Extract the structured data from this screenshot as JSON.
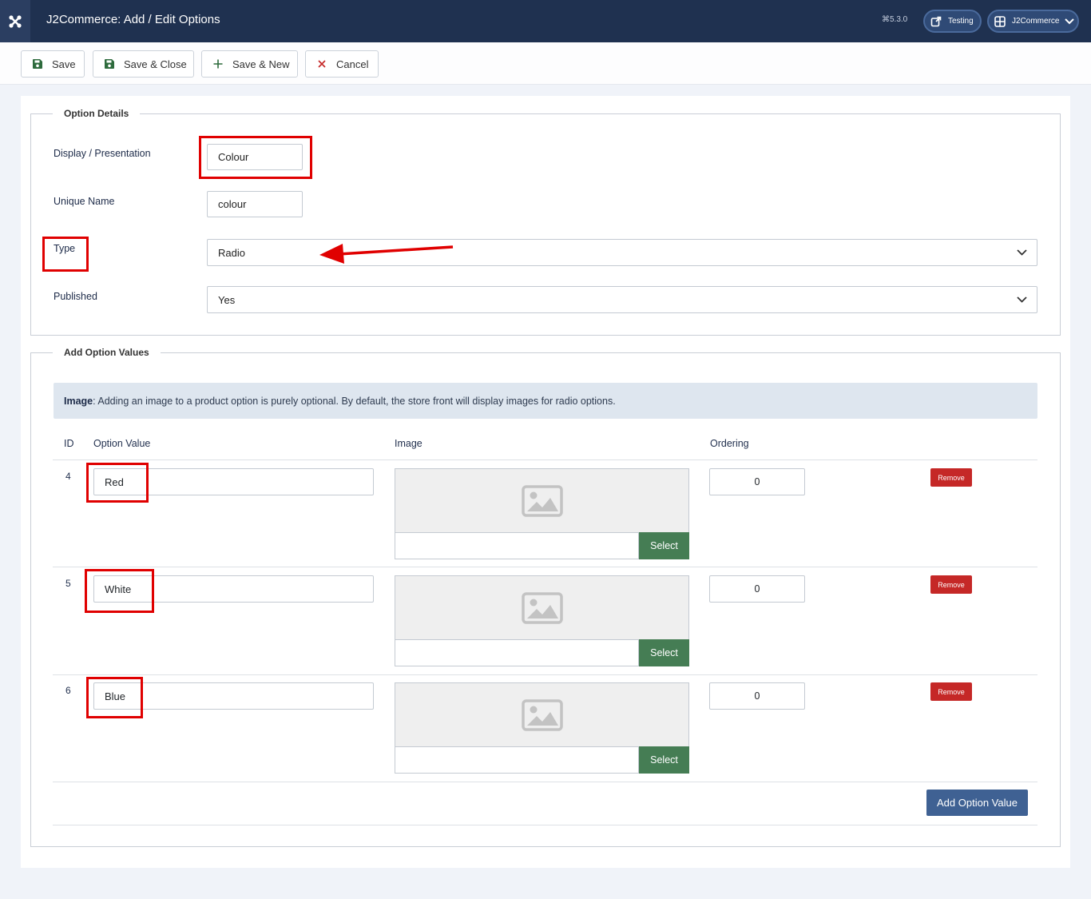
{
  "header": {
    "title": "J2Commerce: Add / Edit Options",
    "version": "5.3.0",
    "testing_label": "Testing",
    "j2commerce_label": "J2Commerce"
  },
  "toolbar": {
    "save": "Save",
    "save_close": "Save & Close",
    "save_new": "Save & New",
    "cancel": "Cancel"
  },
  "option_details": {
    "legend": "Option Details",
    "display_label": "Display / Presentation",
    "display_value": "Colour",
    "unique_label": "Unique Name",
    "unique_value": "colour",
    "type_label": "Type",
    "type_value": "Radio",
    "published_label": "Published",
    "published_value": "Yes"
  },
  "option_values": {
    "legend": "Add Option Values",
    "alert_bold": "Image",
    "alert_text": ": Adding an image to a product option is purely optional. By default, the store front will display images for radio options.",
    "columns": {
      "id": "ID",
      "value": "Option Value",
      "image": "Image",
      "ordering": "Ordering"
    },
    "rows": [
      {
        "id": "4",
        "value": "Red",
        "ordering": "0"
      },
      {
        "id": "5",
        "value": "White",
        "ordering": "0"
      },
      {
        "id": "6",
        "value": "Blue",
        "ordering": "0"
      }
    ],
    "select_label": "Select",
    "remove_label": "Remove",
    "add_button": "Add Option Value"
  },
  "colors": {
    "header_bg": "#1f3150",
    "select_green": "#457d54",
    "remove_red": "#c52827",
    "add_blue": "#3f6193",
    "annotation_red": "#e00000"
  }
}
